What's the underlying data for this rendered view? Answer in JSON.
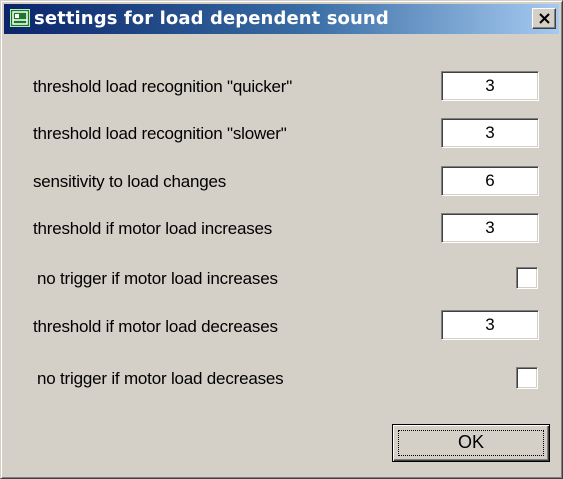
{
  "window": {
    "title": "settings for load dependent sound",
    "icon": "app-window-icon",
    "close_icon": "close-icon"
  },
  "rows": [
    {
      "label": "threshold load recognition \"quicker\"",
      "value": "3"
    },
    {
      "label": "threshold load recognition \"slower\"",
      "value": "3"
    },
    {
      "label": "sensitivity to load changes",
      "value": "6"
    },
    {
      "label": "threshold if motor load increases",
      "value": "3"
    },
    {
      "label": "no trigger if motor load increases",
      "checked": false
    },
    {
      "label": "threshold if motor load decreases",
      "value": "3"
    },
    {
      "label": "no trigger if motor load decreases",
      "checked": false
    }
  ],
  "buttons": {
    "ok_label": "OK"
  },
  "colors": {
    "titlebar_start": "#0a246a",
    "titlebar_end": "#a6caf0",
    "dialog_face": "#d4d0c8"
  }
}
